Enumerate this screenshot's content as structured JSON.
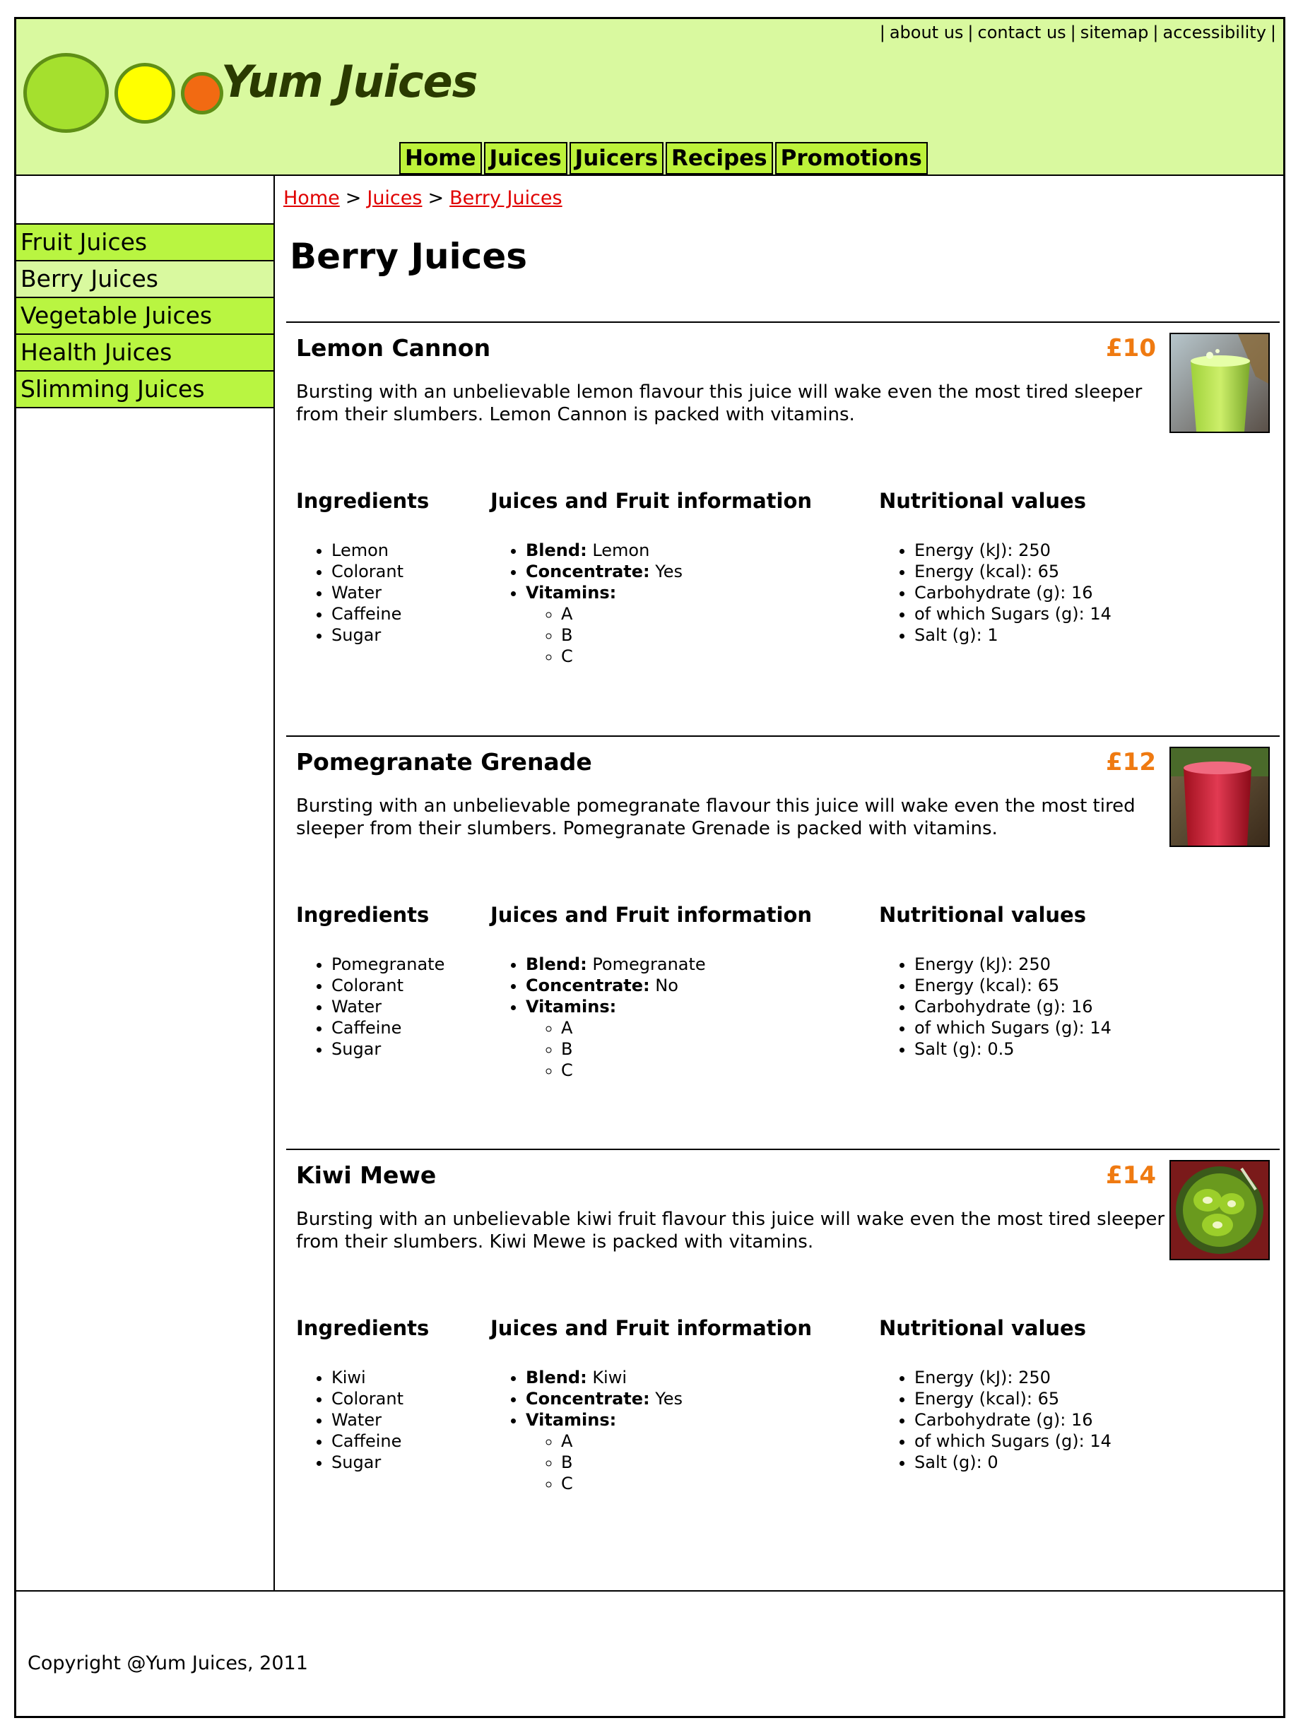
{
  "header": {
    "brand": "Yum Juices",
    "utility_links": [
      "about us",
      "contact us",
      "sitemap",
      "accessibility"
    ],
    "nav": [
      "Home",
      "Juices",
      "Juicers",
      "Recipes",
      "Promotions"
    ],
    "colors": {
      "header_bg": "#d9f99f",
      "nav_bg": "#bdf23a",
      "logo_green": "#a5e02e",
      "logo_yellow": "#ffff00",
      "logo_orange": "#f26a12",
      "brand_text": "#2a3a00"
    }
  },
  "sidebar": {
    "items": [
      "Fruit Juices",
      "Berry Juices",
      "Vegetable Juices",
      "Health Juices",
      "Slimming Juices"
    ],
    "active": "Berry Juices"
  },
  "breadcrumb": [
    "Home",
    "Juices",
    "Berry Juices"
  ],
  "page_title": "Berry Juices",
  "labels": {
    "ingredients": "Ingredients",
    "info": "Juices and Fruit information",
    "nutrition": "Nutritional values",
    "blend": "Blend:",
    "concentrate": "Concentrate:",
    "vitamins": "Vitamins:"
  },
  "products": [
    {
      "name": "Lemon Cannon",
      "price": "£10",
      "image": "green-juice-glass",
      "description": "Bursting with an unbelievable lemon flavour this juice will wake even the most tired sleeper from their slumbers. Lemon Cannon is packed with vitamins.",
      "ingredients": [
        "Lemon",
        "Colorant",
        "Water",
        "Caffeine",
        "Sugar"
      ],
      "blend": "Lemon",
      "concentrate": "Yes",
      "vitamins": [
        "A",
        "B",
        "C"
      ],
      "nutrition": [
        "Energy (kJ): 250",
        "Energy (kcal): 65",
        "Carbohydrate (g): 16",
        "of which Sugars (g): 14",
        "Salt (g): 1"
      ]
    },
    {
      "name": "Pomegranate Grenade",
      "price": "£12",
      "image": "red-juice-glass",
      "description": "Bursting with an unbelievable pomegranate flavour this juice will wake even the most tired sleeper from their slumbers. Pomegranate Grenade is packed with vitamins.",
      "ingredients": [
        "Pomegranate",
        "Colorant",
        "Water",
        "Caffeine",
        "Sugar"
      ],
      "blend": "Pomegranate",
      "concentrate": "No",
      "vitamins": [
        "A",
        "B",
        "C"
      ],
      "nutrition": [
        "Energy (kJ): 250",
        "Energy (kcal): 65",
        "Carbohydrate (g): 16",
        "of which Sugars (g): 14",
        "Salt (g): 0.5"
      ]
    },
    {
      "name": "Kiwi Mewe",
      "price": "£14",
      "image": "kiwi-juice-glass",
      "description": "Bursting with an unbelievable kiwi fruit flavour this juice will wake even the most tired sleeper from their slumbers. Kiwi Mewe is packed with vitamins.",
      "ingredients": [
        "Kiwi",
        "Colorant",
        "Water",
        "Caffeine",
        "Sugar"
      ],
      "blend": "Kiwi",
      "concentrate": "Yes",
      "vitamins": [
        "A",
        "B",
        "C"
      ],
      "nutrition": [
        "Energy (kJ): 250",
        "Energy (kcal): 65",
        "Carbohydrate (g): 16",
        "of which Sugars (g): 14",
        "Salt (g): 0"
      ]
    }
  ],
  "footer": {
    "copyright": "Copyright @Yum Juices, 2011"
  }
}
